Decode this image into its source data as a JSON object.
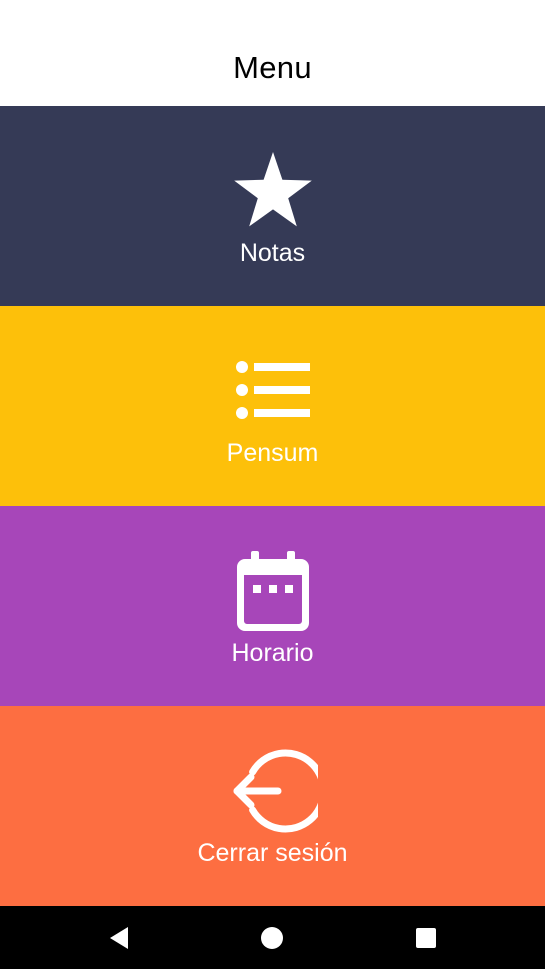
{
  "header": {
    "title": "Menu"
  },
  "menu": {
    "items": [
      {
        "label": "Notas",
        "icon": "star-icon",
        "color": "#353A56"
      },
      {
        "label": "Pensum",
        "icon": "list-icon",
        "color": "#FDC00A"
      },
      {
        "label": "Horario",
        "icon": "calendar-icon",
        "color": "#A746B9"
      },
      {
        "label": "Cerrar sesión",
        "icon": "logout-icon",
        "color": "#FD6E41"
      }
    ]
  },
  "nav_bar": {
    "buttons": [
      "back-icon",
      "home-icon",
      "recents-icon"
    ],
    "color": "#000000"
  }
}
